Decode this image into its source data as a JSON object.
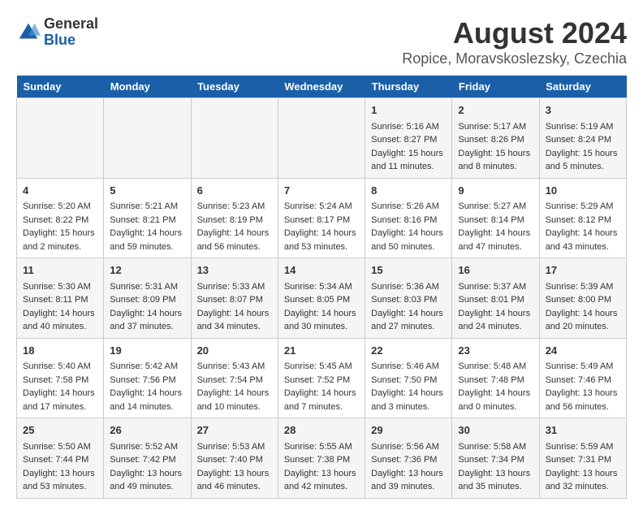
{
  "logo": {
    "general": "General",
    "blue": "Blue"
  },
  "title": "August 2024",
  "subtitle": "Ropice, Moravskoslezsky, Czechia",
  "days_of_week": [
    "Sunday",
    "Monday",
    "Tuesday",
    "Wednesday",
    "Thursday",
    "Friday",
    "Saturday"
  ],
  "weeks": [
    [
      {
        "day": "",
        "content": ""
      },
      {
        "day": "",
        "content": ""
      },
      {
        "day": "",
        "content": ""
      },
      {
        "day": "",
        "content": ""
      },
      {
        "day": "1",
        "content": "Sunrise: 5:16 AM\nSunset: 8:27 PM\nDaylight: 15 hours\nand 11 minutes."
      },
      {
        "day": "2",
        "content": "Sunrise: 5:17 AM\nSunset: 8:26 PM\nDaylight: 15 hours\nand 8 minutes."
      },
      {
        "day": "3",
        "content": "Sunrise: 5:19 AM\nSunset: 8:24 PM\nDaylight: 15 hours\nand 5 minutes."
      }
    ],
    [
      {
        "day": "4",
        "content": "Sunrise: 5:20 AM\nSunset: 8:22 PM\nDaylight: 15 hours\nand 2 minutes."
      },
      {
        "day": "5",
        "content": "Sunrise: 5:21 AM\nSunset: 8:21 PM\nDaylight: 14 hours\nand 59 minutes."
      },
      {
        "day": "6",
        "content": "Sunrise: 5:23 AM\nSunset: 8:19 PM\nDaylight: 14 hours\nand 56 minutes."
      },
      {
        "day": "7",
        "content": "Sunrise: 5:24 AM\nSunset: 8:17 PM\nDaylight: 14 hours\nand 53 minutes."
      },
      {
        "day": "8",
        "content": "Sunrise: 5:26 AM\nSunset: 8:16 PM\nDaylight: 14 hours\nand 50 minutes."
      },
      {
        "day": "9",
        "content": "Sunrise: 5:27 AM\nSunset: 8:14 PM\nDaylight: 14 hours\nand 47 minutes."
      },
      {
        "day": "10",
        "content": "Sunrise: 5:29 AM\nSunset: 8:12 PM\nDaylight: 14 hours\nand 43 minutes."
      }
    ],
    [
      {
        "day": "11",
        "content": "Sunrise: 5:30 AM\nSunset: 8:11 PM\nDaylight: 14 hours\nand 40 minutes."
      },
      {
        "day": "12",
        "content": "Sunrise: 5:31 AM\nSunset: 8:09 PM\nDaylight: 14 hours\nand 37 minutes."
      },
      {
        "day": "13",
        "content": "Sunrise: 5:33 AM\nSunset: 8:07 PM\nDaylight: 14 hours\nand 34 minutes."
      },
      {
        "day": "14",
        "content": "Sunrise: 5:34 AM\nSunset: 8:05 PM\nDaylight: 14 hours\nand 30 minutes."
      },
      {
        "day": "15",
        "content": "Sunrise: 5:36 AM\nSunset: 8:03 PM\nDaylight: 14 hours\nand 27 minutes."
      },
      {
        "day": "16",
        "content": "Sunrise: 5:37 AM\nSunset: 8:01 PM\nDaylight: 14 hours\nand 24 minutes."
      },
      {
        "day": "17",
        "content": "Sunrise: 5:39 AM\nSunset: 8:00 PM\nDaylight: 14 hours\nand 20 minutes."
      }
    ],
    [
      {
        "day": "18",
        "content": "Sunrise: 5:40 AM\nSunset: 7:58 PM\nDaylight: 14 hours\nand 17 minutes."
      },
      {
        "day": "19",
        "content": "Sunrise: 5:42 AM\nSunset: 7:56 PM\nDaylight: 14 hours\nand 14 minutes."
      },
      {
        "day": "20",
        "content": "Sunrise: 5:43 AM\nSunset: 7:54 PM\nDaylight: 14 hours\nand 10 minutes."
      },
      {
        "day": "21",
        "content": "Sunrise: 5:45 AM\nSunset: 7:52 PM\nDaylight: 14 hours\nand 7 minutes."
      },
      {
        "day": "22",
        "content": "Sunrise: 5:46 AM\nSunset: 7:50 PM\nDaylight: 14 hours\nand 3 minutes."
      },
      {
        "day": "23",
        "content": "Sunrise: 5:48 AM\nSunset: 7:48 PM\nDaylight: 14 hours\nand 0 minutes."
      },
      {
        "day": "24",
        "content": "Sunrise: 5:49 AM\nSunset: 7:46 PM\nDaylight: 13 hours\nand 56 minutes."
      }
    ],
    [
      {
        "day": "25",
        "content": "Sunrise: 5:50 AM\nSunset: 7:44 PM\nDaylight: 13 hours\nand 53 minutes."
      },
      {
        "day": "26",
        "content": "Sunrise: 5:52 AM\nSunset: 7:42 PM\nDaylight: 13 hours\nand 49 minutes."
      },
      {
        "day": "27",
        "content": "Sunrise: 5:53 AM\nSunset: 7:40 PM\nDaylight: 13 hours\nand 46 minutes."
      },
      {
        "day": "28",
        "content": "Sunrise: 5:55 AM\nSunset: 7:38 PM\nDaylight: 13 hours\nand 42 minutes."
      },
      {
        "day": "29",
        "content": "Sunrise: 5:56 AM\nSunset: 7:36 PM\nDaylight: 13 hours\nand 39 minutes."
      },
      {
        "day": "30",
        "content": "Sunrise: 5:58 AM\nSunset: 7:34 PM\nDaylight: 13 hours\nand 35 minutes."
      },
      {
        "day": "31",
        "content": "Sunrise: 5:59 AM\nSunset: 7:31 PM\nDaylight: 13 hours\nand 32 minutes."
      }
    ]
  ]
}
